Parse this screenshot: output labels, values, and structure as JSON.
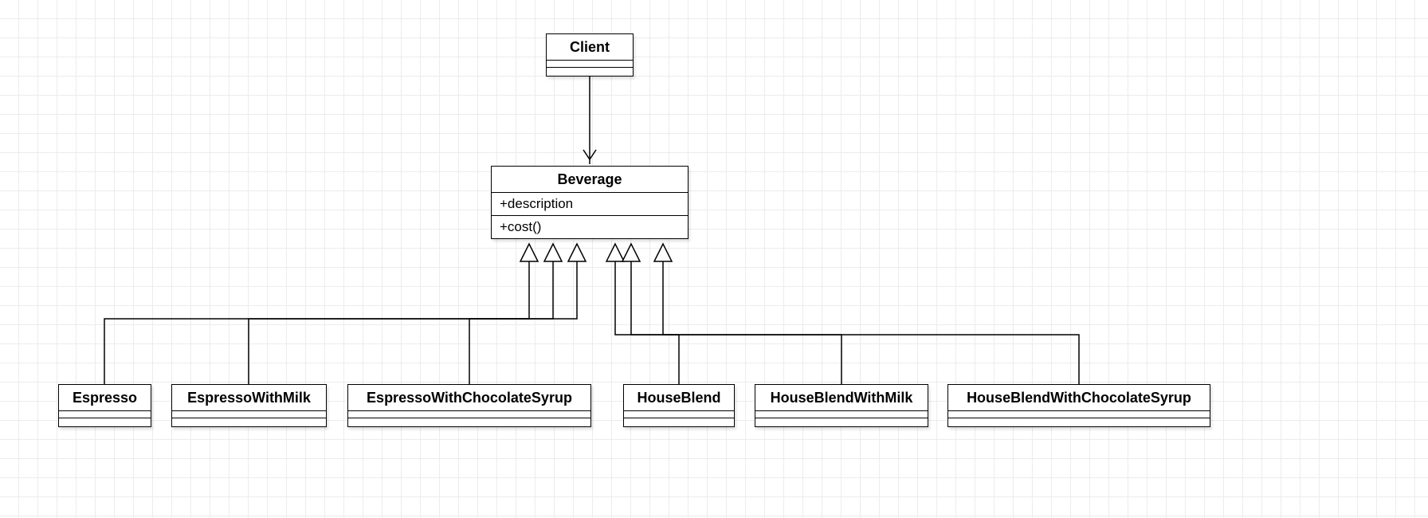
{
  "classes": {
    "client": {
      "name": "Client"
    },
    "beverage": {
      "name": "Beverage",
      "attrs": [
        "+description"
      ],
      "ops": [
        "+cost()"
      ]
    },
    "espresso": {
      "name": "Espresso"
    },
    "espressoWithMilk": {
      "name": "EspressoWithMilk"
    },
    "espressoWithChocolateSyrup": {
      "name": "EspressoWithChocolateSyrup"
    },
    "houseBlend": {
      "name": "HouseBlend"
    },
    "houseBlendWithMilk": {
      "name": "HouseBlendWithMilk"
    },
    "houseBlendWithChocolateSyrup": {
      "name": "HouseBlendWithChocolateSyrup"
    }
  },
  "relations": [
    {
      "from": "client",
      "to": "beverage",
      "type": "association-arrow"
    },
    {
      "from": "espresso",
      "to": "beverage",
      "type": "generalization"
    },
    {
      "from": "espressoWithMilk",
      "to": "beverage",
      "type": "generalization"
    },
    {
      "from": "espressoWithChocolateSyrup",
      "to": "beverage",
      "type": "generalization"
    },
    {
      "from": "houseBlend",
      "to": "beverage",
      "type": "generalization"
    },
    {
      "from": "houseBlendWithMilk",
      "to": "beverage",
      "type": "generalization"
    },
    {
      "from": "houseBlendWithChocolateSyrup",
      "to": "beverage",
      "type": "generalization"
    }
  ]
}
